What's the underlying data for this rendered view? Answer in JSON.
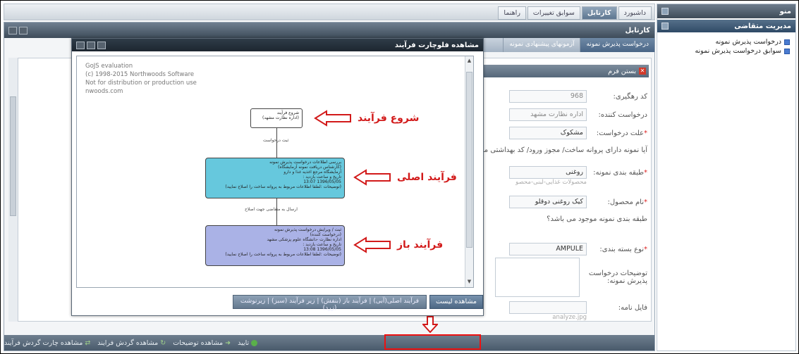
{
  "sidebar": {
    "menu_title": "منو",
    "section_title": "مدیریت متقاضی",
    "items": [
      {
        "label": "درخواست پذیرش نمونه"
      },
      {
        "label": "سوابق درخواست پذیرش نمونه"
      }
    ]
  },
  "top_tabs": [
    {
      "label": "داشبورد"
    },
    {
      "label": "کارتابل"
    },
    {
      "label": "سوابق تغییرات"
    },
    {
      "label": "راهنما"
    }
  ],
  "panel": {
    "title": "کارتابل",
    "sub_tabs": [
      {
        "label": "درخواست پذیرش نمونه"
      },
      {
        "label": "آزمونهای پیشنهادی نمونه"
      }
    ],
    "close_form": "بستن فرم"
  },
  "form": {
    "tracking_label": "کد رهگیری:",
    "tracking_value": "968",
    "requester_label": "درخواست کننده:",
    "requester_value": "اداره نظارت مشهد",
    "reason_label": "علت درخواست:",
    "reason_value": "مشکوک",
    "question_label": "آیا نمونه دارای پروانه ساخت/ مجوز ورود/ کد بهداشتی می",
    "classification_label": "طبقه بندی نمونه:",
    "classification_value": "روغنی",
    "classification_sub": "محصولات غذایی-لبنی-محصو",
    "product_label": "نام محصول:",
    "product_value": "کیک روغنی دوقلو",
    "existing_label": "طبقه بندی نمونه موجود می باشد؟",
    "package_label": "نوع بسته بندی:",
    "package_value": "AMPULE",
    "desc_label": "توضیحات درخواست پذیرش نمونه:",
    "file_label": "فایل نامه:",
    "file_value": "analyze.jpg"
  },
  "bottom_bar": {
    "approve": "تایید",
    "view_notes": "مشاهده توضیحات",
    "view_cycle": "مشاهده گردش فرایند",
    "view_flowchart": "مشاهده چارت گردش فرآیند"
  },
  "modal": {
    "title": "مشاهده فلوچارت فرآیند",
    "gojs_lines": [
      "GoJS evaluation",
      "(c) 1998-2015 Northwoods Software",
      "Not for distribution or production use",
      "nwoods.com"
    ],
    "nodes": {
      "start": [
        "شروع فرآیند",
        "(اداره نظارت مشهد)"
      ],
      "main": [
        "بررسی اطلاعات درخواست پذیرش نمونه",
        "(کارشناس دریافت نمونه آزمایشگاه)",
        "آزمایشگاه مرجع اغذیه غذا و دارو",
        "تاریخ و ساعت بازدید :",
        "1396/05/05 13:07",
        "(توضیحات :لطفا اطلاعات مربوط به پروانه ساخت را اصلاح نمایید)"
      ],
      "open": [
        "ثبت / ویرایش درخواست پذیرش نمونه",
        "(درخواست کننده)",
        "اداره نظارت -دانشگاه علوم پزشکی مشهد",
        "تاریخ و ساعت بازدید :",
        "1396/05/05 13:08",
        "(توضیحات :لطفا اطلاعات مربوط به پروانه ساخت را اصلاح نمایید)"
      ]
    },
    "edges": {
      "first": "ثبت درخواست",
      "second": "ارسال به متقاضی جهت اصلاح"
    },
    "callouts": {
      "start": "شروع فرآیند",
      "main": "فرآیند اصلی",
      "open": "فرآیند باز"
    },
    "close_button": "مشاهده لیست",
    "legend": "فرآیند اصلی(آبی) | فرآیند باز (بنفش) | زیر فرآیند (سبز) | زیرنوشت (زرد)"
  },
  "colors": {
    "main_node": "#66c8dd",
    "open_node": "#aab2e6",
    "callout": "#d21a1a",
    "highlight": "#e11"
  }
}
